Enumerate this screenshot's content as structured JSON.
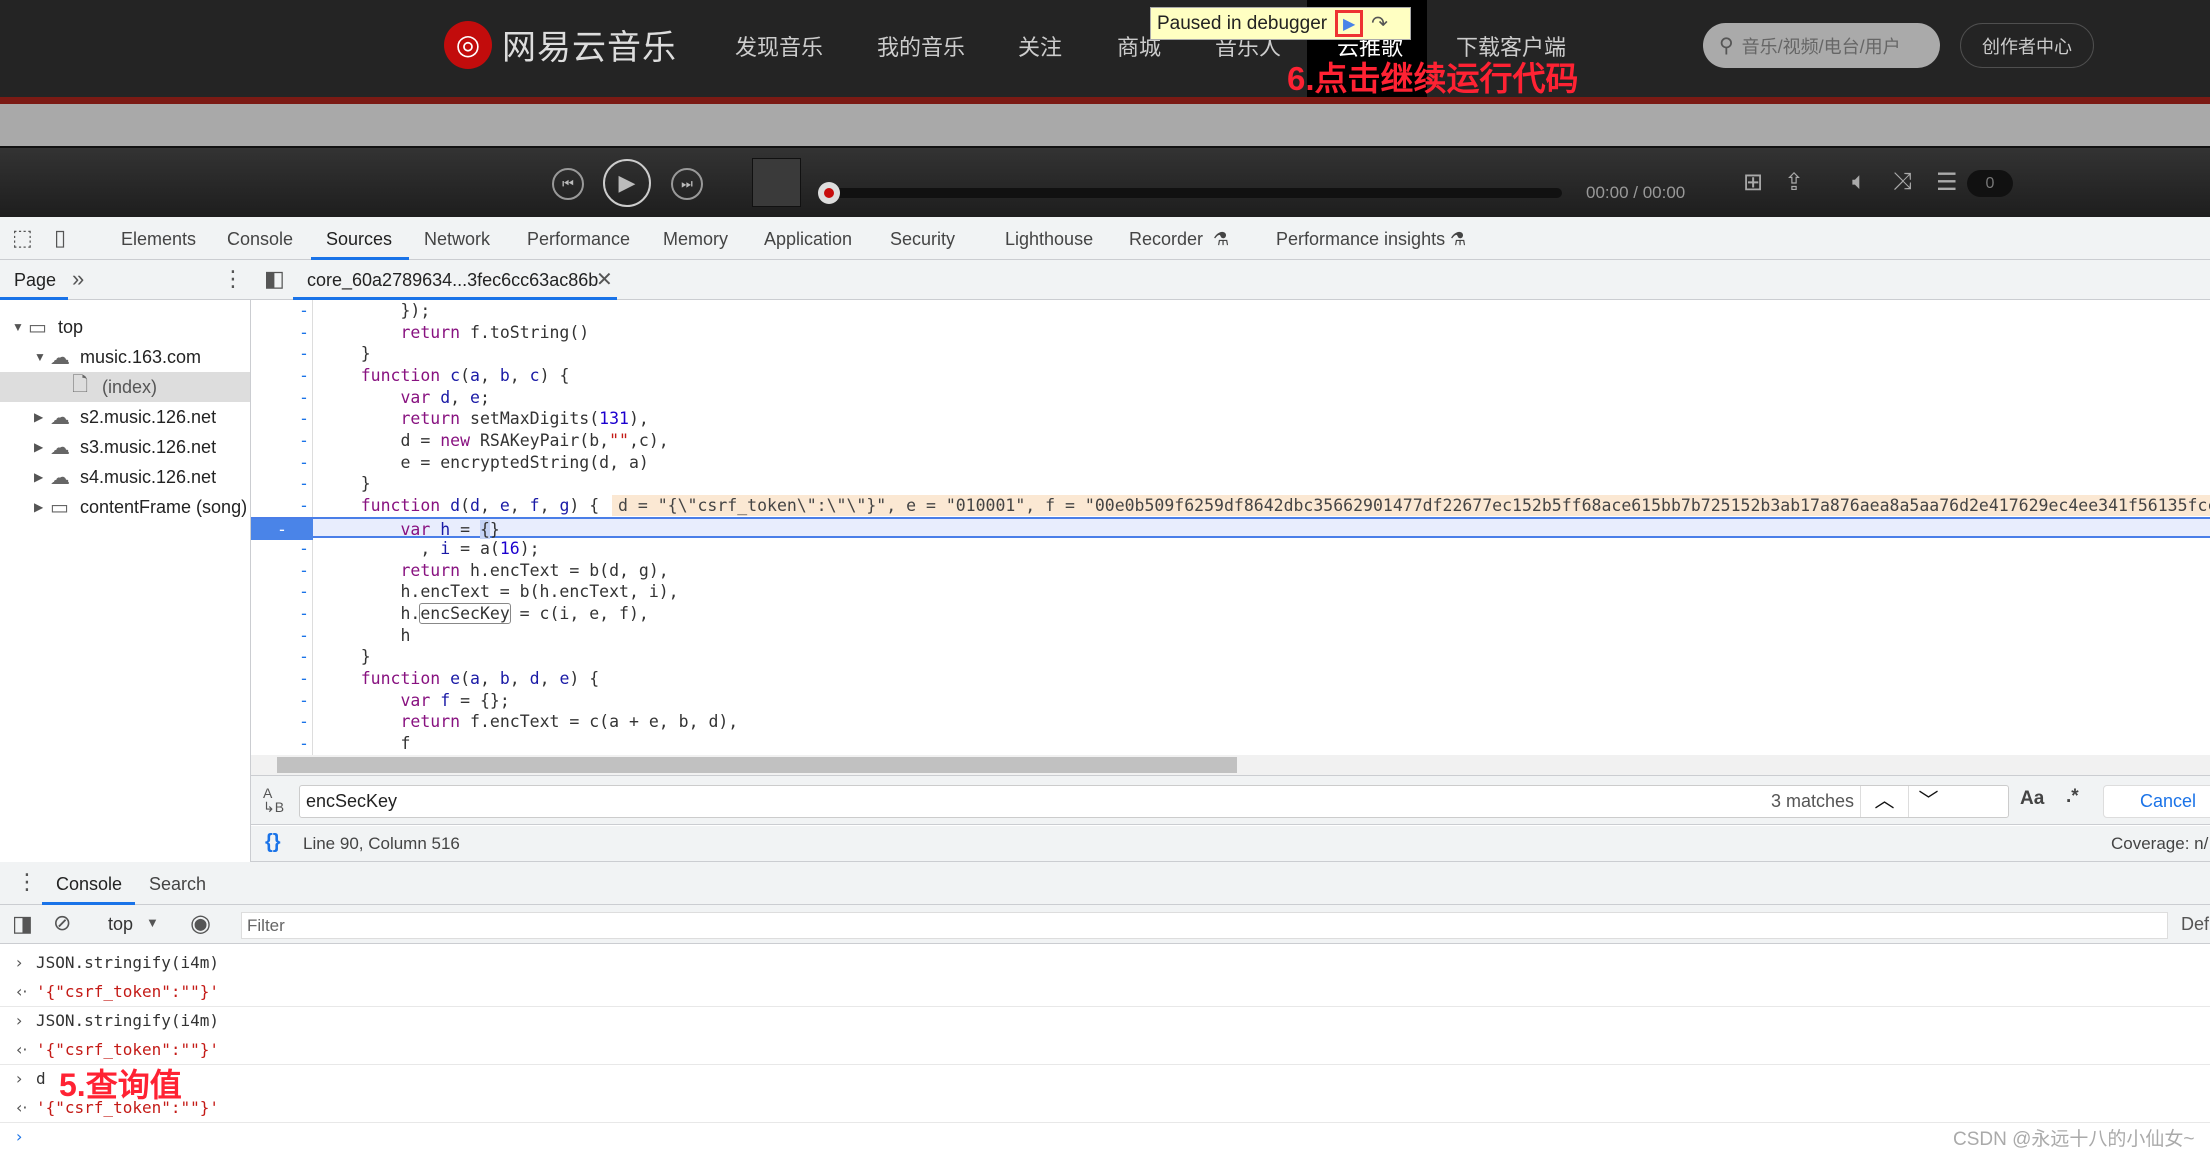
{
  "site": {
    "logo_text": "网易云音乐",
    "nav": [
      "发现音乐",
      "我的音乐",
      "关注",
      "商城",
      "音乐人",
      "云推歌",
      "下载客户端"
    ],
    "search_placeholder": "音乐/视频/电台/用户",
    "creator_button": "创作者中心",
    "brand_color": "#c20c0c"
  },
  "debugger_overlay": {
    "label": "Paused in debugger",
    "resume_icon": "resume-icon",
    "step_icon": "step-over-icon"
  },
  "annotations": {
    "step6": "6.点击继续运行代码",
    "step5": "5.查询值",
    "color": "#ff2233"
  },
  "player": {
    "time": "00:00 / 00:00",
    "volume": "0",
    "progress": 0
  },
  "devtools": {
    "tabs": [
      "Elements",
      "Console",
      "Sources",
      "Network",
      "Performance",
      "Memory",
      "Application",
      "Security",
      "Lighthouse",
      "Recorder",
      "Performance insights"
    ],
    "active_tab": "Sources",
    "navigator": {
      "tab": "Page",
      "more": "»",
      "tree": [
        {
          "label": "top",
          "icon": "frame-icon",
          "expanded": true,
          "depth": 0
        },
        {
          "label": "music.163.com",
          "icon": "cloud-icon",
          "expanded": true,
          "depth": 1
        },
        {
          "label": "(index)",
          "icon": "file-icon",
          "depth": 2,
          "selected": true
        },
        {
          "label": "s2.music.126.net",
          "icon": "cloud-icon",
          "expanded": false,
          "depth": 1
        },
        {
          "label": "s3.music.126.net",
          "icon": "cloud-icon",
          "expanded": false,
          "depth": 1
        },
        {
          "label": "s4.music.126.net",
          "icon": "cloud-icon",
          "expanded": false,
          "depth": 1
        },
        {
          "label": "contentFrame (song)",
          "icon": "frame-icon",
          "expanded": false,
          "depth": 1
        }
      ]
    },
    "file_tab": "core_60a2789634...3fec6cc63ac86b",
    "code": [
      [
        [
          "p",
          "        });"
        ]
      ],
      [
        [
          "p",
          "        "
        ],
        [
          "k",
          "return"
        ],
        [
          "p",
          " f.toString()"
        ]
      ],
      [
        [
          "p",
          "    }"
        ]
      ],
      [
        [
          "p",
          "    "
        ],
        [
          "k",
          "function"
        ],
        [
          "p",
          " "
        ],
        [
          "v",
          "c"
        ],
        [
          "p",
          "("
        ],
        [
          "v",
          "a"
        ],
        [
          "p",
          ", "
        ],
        [
          "v",
          "b"
        ],
        [
          "p",
          ", "
        ],
        [
          "v",
          "c"
        ],
        [
          "p",
          ") {"
        ]
      ],
      [
        [
          "p",
          "        "
        ],
        [
          "k",
          "var"
        ],
        [
          "p",
          " "
        ],
        [
          "v",
          "d"
        ],
        [
          "p",
          ", "
        ],
        [
          "v",
          "e"
        ],
        [
          "p",
          ";"
        ]
      ],
      [
        [
          "p",
          "        "
        ],
        [
          "k",
          "return"
        ],
        [
          "p",
          " setMaxDigits("
        ],
        [
          "n",
          "131"
        ],
        [
          "p",
          "),"
        ]
      ],
      [
        [
          "p",
          "        d = "
        ],
        [
          "k",
          "new"
        ],
        [
          "p",
          " RSAKeyPair(b,"
        ],
        [
          "s",
          "\"\""
        ],
        [
          "p",
          ",c),"
        ]
      ],
      [
        [
          "p",
          "        e = encryptedString(d, a)"
        ]
      ],
      [
        [
          "p",
          "    }"
        ]
      ],
      [
        [
          "p",
          "    "
        ],
        [
          "k",
          "function"
        ],
        [
          "p",
          " "
        ],
        [
          "v",
          "d"
        ],
        [
          "p",
          "("
        ],
        [
          "v",
          "d"
        ],
        [
          "p",
          ", "
        ],
        [
          "v",
          "e"
        ],
        [
          "p",
          ", "
        ],
        [
          "v",
          "f"
        ],
        [
          "p",
          ", "
        ],
        [
          "v",
          "g"
        ],
        [
          "p",
          ") {"
        ]
      ],
      [
        [
          "p",
          "        "
        ],
        [
          "k",
          "var"
        ],
        [
          "p",
          " "
        ],
        [
          "v",
          "h"
        ],
        [
          "p",
          " = "
        ],
        [
          "c",
          "{"
        ],
        [
          "p",
          "}"
        ]
      ],
      [
        [
          "p",
          "          , "
        ],
        [
          "v",
          "i"
        ],
        [
          "p",
          " = a("
        ],
        [
          "n",
          "16"
        ],
        [
          "p",
          ");"
        ]
      ],
      [
        [
          "p",
          "        "
        ],
        [
          "k",
          "return"
        ],
        [
          "p",
          " h.encText = b(d, g),"
        ]
      ],
      [
        [
          "p",
          "        h.encText = b(h.encText, i),"
        ]
      ],
      [
        [
          "p",
          "        h."
        ],
        [
          "m",
          "encSecKey"
        ],
        [
          "p",
          " = c(i, e, f),"
        ]
      ],
      [
        [
          "p",
          "        h"
        ]
      ],
      [
        [
          "p",
          "    }"
        ]
      ],
      [
        [
          "p",
          "    "
        ],
        [
          "k",
          "function"
        ],
        [
          "p",
          " "
        ],
        [
          "v",
          "e"
        ],
        [
          "p",
          "("
        ],
        [
          "v",
          "a"
        ],
        [
          "p",
          ", "
        ],
        [
          "v",
          "b"
        ],
        [
          "p",
          ", "
        ],
        [
          "v",
          "d"
        ],
        [
          "p",
          ", "
        ],
        [
          "v",
          "e"
        ],
        [
          "p",
          ") {"
        ]
      ],
      [
        [
          "p",
          "        "
        ],
        [
          "k",
          "var"
        ],
        [
          "p",
          " "
        ],
        [
          "v",
          "f"
        ],
        [
          "p",
          " = {};"
        ]
      ],
      [
        [
          "p",
          "        "
        ],
        [
          "k",
          "return"
        ],
        [
          "p",
          " f.encText = c(a + e, b, d),"
        ]
      ],
      [
        [
          "p",
          "        f"
        ]
      ]
    ],
    "paused_line_index": 10,
    "inline_value_line_index": 9,
    "inline_value": "d = \"{\\\"csrf_token\\\":\\\"\\\"}\", e = \"010001\", f = \"00e0b509f6259df8642dbc35662901477df22677ec152b5ff68ace615bb7b725152b3ab17a876aea8a5aa76d2e417629ec4ee341f56135fcc",
    "find": {
      "query": "encSecKey",
      "matches": "3 matches",
      "match_case": "Aa",
      "regex": ".*",
      "cancel": "Cancel"
    },
    "status": {
      "position": "Line 90, Column 516",
      "coverage": "Coverage: n/"
    },
    "drawer": {
      "tabs": [
        "Console",
        "Search"
      ],
      "active": "Console"
    },
    "console": {
      "context": "top",
      "filter_placeholder": "Filter",
      "levels": "Def",
      "entries": [
        {
          "type": "input",
          "text": "JSON.stringify(i4m)"
        },
        {
          "type": "output",
          "text": "'{\"csrf_token\":\"\"}'"
        },
        {
          "type": "input",
          "text": "JSON.stringify(i4m)"
        },
        {
          "type": "output",
          "text": "'{\"csrf_token\":\"\"}'"
        },
        {
          "type": "input",
          "text": "d"
        },
        {
          "type": "output",
          "text": "'{\"csrf_token\":\"\"}'"
        }
      ]
    }
  },
  "watermark": "CSDN @永远十八的小仙女~"
}
